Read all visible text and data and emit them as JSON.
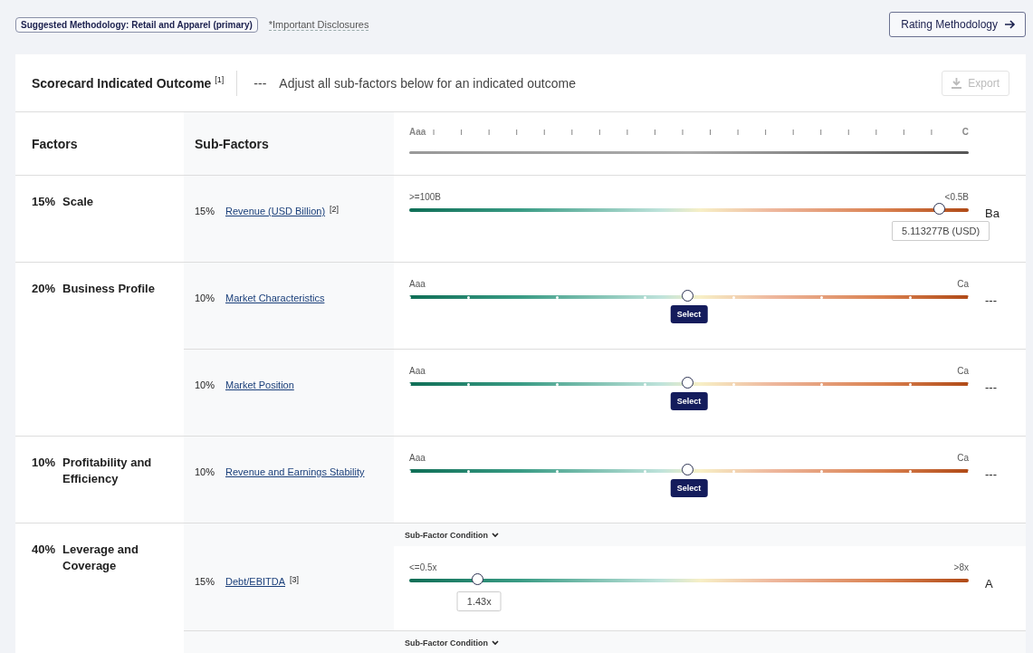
{
  "top_bar": {
    "methodology_badge": "Suggested Methodology: Retail and Apparel (primary)",
    "disclosures_link": "*Important Disclosures",
    "rating_button": "Rating Methodology"
  },
  "scorecard": {
    "title": "Scorecard Indicated Outcome",
    "note": "[1]",
    "outcome": "---",
    "hint": "Adjust all sub-factors below for an indicated outcome",
    "export_button": {
      "label": "Export",
      "disabled": true
    }
  },
  "columns": {
    "factors": "Factors",
    "sub_factors": "Sub-Factors",
    "scale_start": "Aaa",
    "scale_end": "C"
  },
  "factors": [
    {
      "weight": "15%",
      "name": "Scale",
      "sub_factors": [
        {
          "kind": "numeric",
          "weight": "15%",
          "name": "Revenue (USD Billion)",
          "note": "[2]",
          "min_label": ">=100B",
          "max_label": "<0.5B",
          "level": 0.95,
          "value": "5.113277B (USD)",
          "result": "Ba"
        }
      ]
    },
    {
      "weight": "20%",
      "name": "Business Profile",
      "sub_factors": [
        {
          "kind": "qualitative",
          "weight": "10%",
          "name": "Market Characteristics",
          "min_label": "Aaa",
          "max_label": "Ca",
          "level": 0.5,
          "select_button": "Select",
          "result": "---"
        },
        {
          "kind": "qualitative",
          "weight": "10%",
          "name": "Market Position",
          "min_label": "Aaa",
          "max_label": "Ca",
          "level": 0.5,
          "select_button": "Select",
          "result": "---"
        }
      ]
    },
    {
      "weight": "10%",
      "name": "Profitability and Efficiency",
      "sub_factors": [
        {
          "kind": "qualitative",
          "weight": "10%",
          "name": "Revenue and Earnings Stability",
          "min_label": "Aaa",
          "max_label": "Ca",
          "level": 0.5,
          "select_button": "Select",
          "result": "---"
        }
      ]
    },
    {
      "weight": "40%",
      "name": "Leverage and Coverage",
      "sub_factors": [
        {
          "kind": "numeric",
          "condition": "Sub-Factor Condition",
          "weight": "15%",
          "name": "Debt/EBITDA",
          "note": "[3]",
          "min_label": "<=0.5x",
          "max_label": ">8x",
          "level": 0.125,
          "value": "1.43x",
          "result": "A"
        },
        {
          "kind": "condition_only",
          "condition": "Sub-Factor Condition"
        }
      ]
    }
  ]
}
